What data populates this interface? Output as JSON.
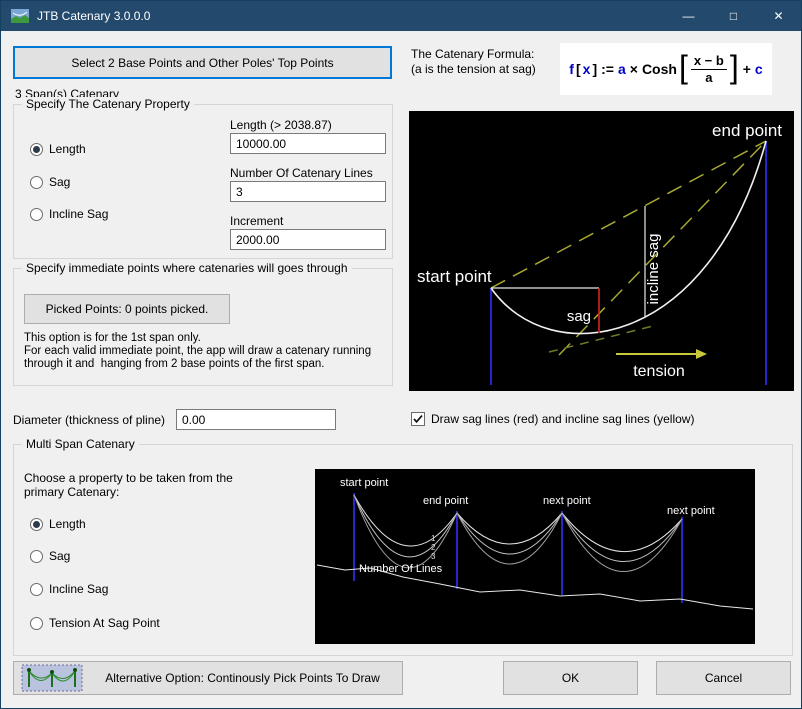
{
  "window": {
    "title": "JTB Catenary 3.0.0.0",
    "minimize_glyph": "—",
    "maximize_glyph": "□",
    "close_glyph": "✕"
  },
  "header": {
    "select_button": "Select 2 Base Points and Other Poles' Top Points",
    "formula_caption_1": "The Catenary Formula:",
    "formula_caption_2": "(a is the tension at sag)",
    "formula": {
      "f": "f",
      "open_bracket": "[",
      "x": "x",
      "close_bracket": "]",
      "assign": ":=",
      "a": "a",
      "times": "×",
      "cosh": "Cosh",
      "big_open": "[",
      "numerator": "x − b",
      "denominator": "a",
      "big_close": "]",
      "plus": "+",
      "c": "c"
    }
  },
  "spans_label": "3 Span(s) Catenary",
  "property_group": {
    "title": "Specify The Catenary Property",
    "radios": [
      {
        "label": "Length",
        "checked": true
      },
      {
        "label": "Sag",
        "checked": false
      },
      {
        "label": "Incline Sag",
        "checked": false
      }
    ],
    "fields": [
      {
        "label": "Length (> 2038.87)",
        "value": "10000.00"
      },
      {
        "label": "Number Of Catenary Lines",
        "value": "3"
      },
      {
        "label": "Increment",
        "value": "2000.00"
      }
    ]
  },
  "immediate_group": {
    "title": "Specify immediate points where catenaries will goes through",
    "picked_button": "Picked Points: 0 points picked.",
    "notes": [
      "This option is for the 1st span only.",
      "For each valid immediate point, the app will draw a catenary running",
      "through it and  hanging from 2 base points of the first span."
    ]
  },
  "diameter": {
    "label": "Diameter (thickness of pline)",
    "value": "0.00"
  },
  "sag_lines_checkbox": {
    "label": "Draw sag lines (red) and incline sag lines (yellow)",
    "checked": true
  },
  "diagram_single": {
    "start_point": "start point",
    "end_point": "end point",
    "sag": "sag",
    "incline_sag": "incline sag",
    "tension": "tension"
  },
  "multi_group": {
    "title": "Multi Span Catenary",
    "caption_1": "Choose a property to be taken from the",
    "caption_2": "primary Catenary:",
    "radios": [
      {
        "label": "Length",
        "checked": true
      },
      {
        "label": "Sag",
        "checked": false
      },
      {
        "label": "Incline Sag",
        "checked": false
      },
      {
        "label": "Tension At Sag Point",
        "checked": false
      }
    ]
  },
  "diagram_multi": {
    "start_point": "start point",
    "end_point": "end point",
    "next_point_1": "next point",
    "next_point_2": "next point",
    "number_of_lines": "Number Of Lines",
    "line_numbers": [
      "1",
      "2",
      "3"
    ]
  },
  "footer": {
    "alternative_button": "Alternative Option: Continously Pick Points To Draw",
    "ok_button": "OK",
    "cancel_button": "Cancel"
  },
  "colors": {
    "titlebar": "#234a6d",
    "accent": "#0078d7",
    "sag_line": "#cc2222",
    "incline_sag_line": "#a8a832",
    "pole": "#2626cc"
  }
}
